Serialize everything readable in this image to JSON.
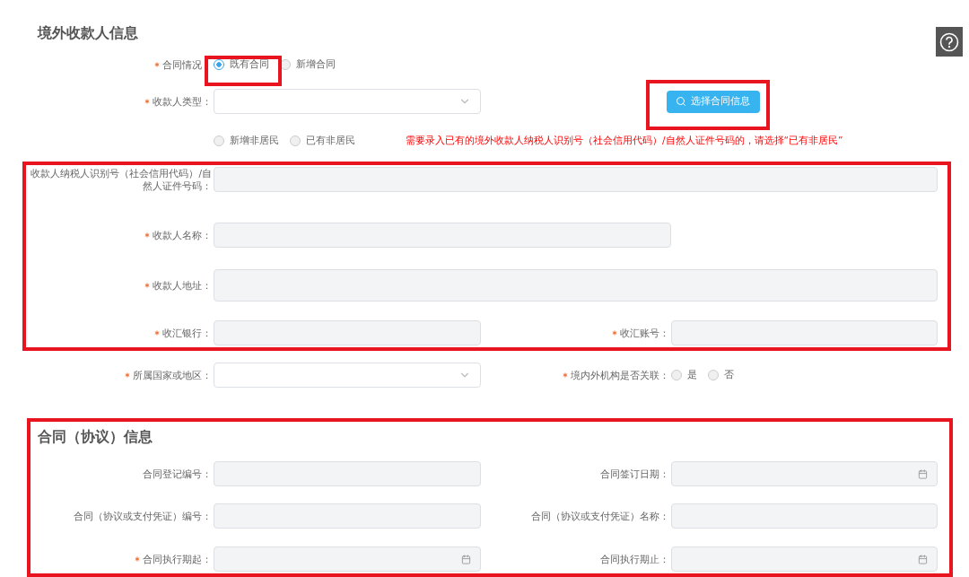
{
  "payee_section": {
    "title": "境外收款人信息",
    "contract_status": {
      "label": "合同情况：",
      "required": true,
      "options": [
        {
          "label": "既有合同",
          "selected": true
        },
        {
          "label": "新增合同",
          "selected": false
        }
      ]
    },
    "payee_type": {
      "label": "收款人类型：",
      "required": true
    },
    "select_button": {
      "label": "选择合同信息"
    },
    "resident_options": [
      {
        "label": "新增非居民",
        "selected": false
      },
      {
        "label": "已有非居民",
        "selected": false
      }
    ],
    "notice": "需要录入已有的境外收款人纳税人识别号（社会信用代码）/自然人证件号码的，请选择“已有非居民”",
    "fields": [
      {
        "label": "收款人纳税人识别号（社会信用代码）/自然人证件号码：",
        "required": false,
        "kind": "full"
      },
      {
        "label": "收款人名称：",
        "required": true,
        "kind": "wide"
      },
      {
        "label": "收款人地址：",
        "required": true,
        "kind": "area"
      },
      {
        "label": "收汇银行：",
        "required": true,
        "kind": "half"
      },
      {
        "label": "收汇账号：",
        "required": true,
        "kind": "half"
      }
    ],
    "country": {
      "label": "所属国家或地区：",
      "required": true
    },
    "related": {
      "label": "境内外机构是否关联：",
      "required": true,
      "options": [
        {
          "label": "是",
          "selected": false
        },
        {
          "label": "否",
          "selected": false
        }
      ]
    }
  },
  "contract_section": {
    "title": "合同（协议）信息",
    "fields": [
      {
        "label": "合同登记编号：",
        "required": false,
        "kind": "text"
      },
      {
        "label": "合同签订日期：",
        "required": false,
        "kind": "date"
      },
      {
        "label": "合同（协议或支付凭证）编号：",
        "required": false,
        "kind": "text"
      },
      {
        "label": "合同（协议或支付凭证）名称：",
        "required": false,
        "kind": "text"
      },
      {
        "label": "合同执行期起：",
        "required": true,
        "kind": "date"
      },
      {
        "label": "合同执行期止：",
        "required": false,
        "kind": "date"
      }
    ]
  }
}
